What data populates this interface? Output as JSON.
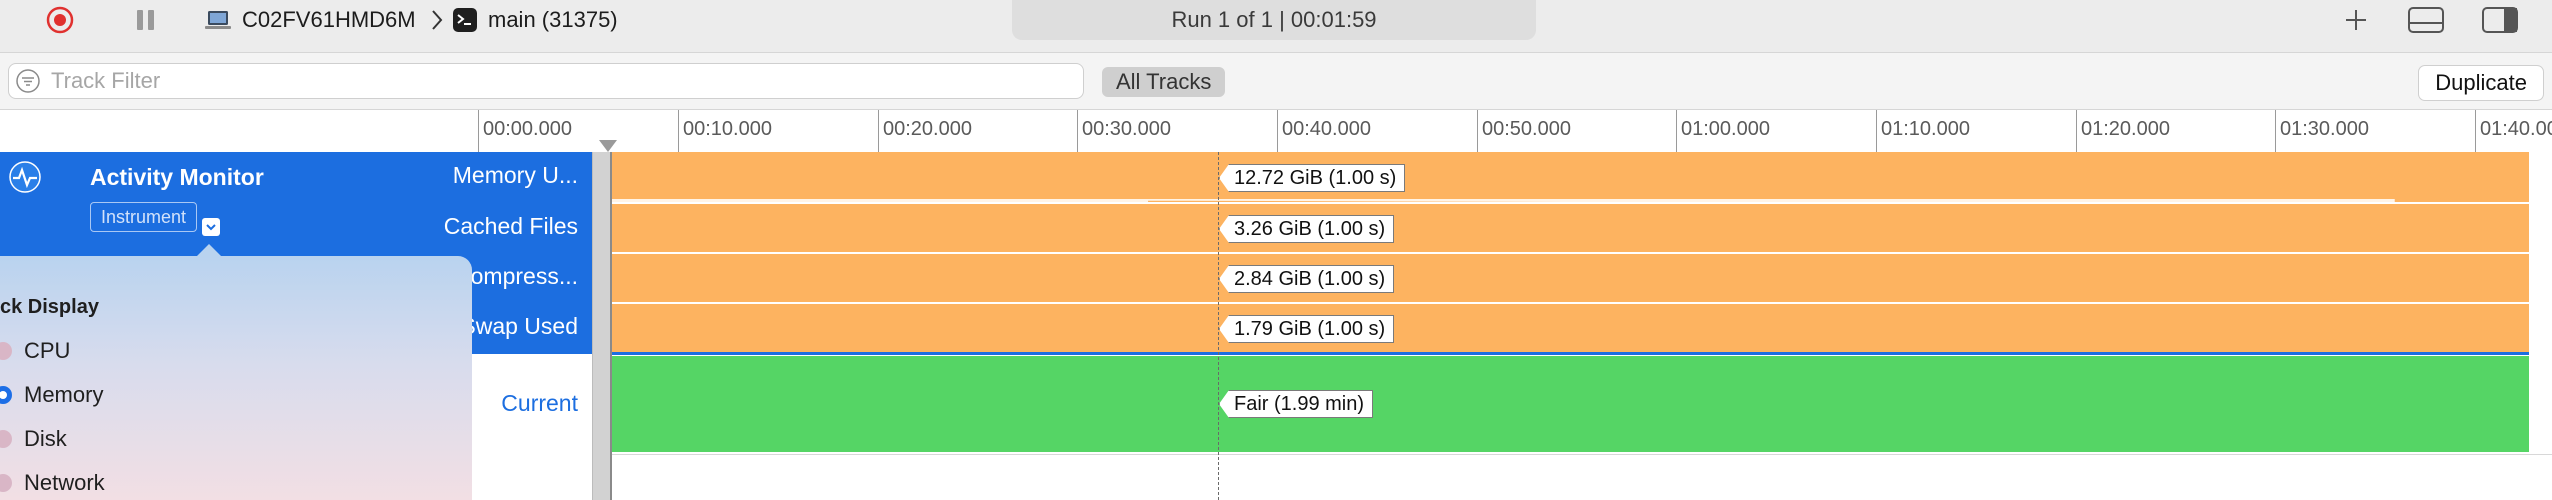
{
  "toolbar": {
    "device_name": "C02FV61HMD6M",
    "target_name": "main (31375)",
    "run_status": "Run 1 of 1  |  00:01:59"
  },
  "filter": {
    "placeholder": "Track Filter",
    "all_tracks_label": "All Tracks",
    "duplicate_label": "Duplicate"
  },
  "ruler": {
    "ticks": [
      "00:00.000",
      "00:10.000",
      "00:20.000",
      "00:30.000",
      "00:40.000",
      "00:50.000",
      "01:00.000",
      "01:10.000",
      "01:20.000",
      "01:30.000",
      "01:40.000"
    ]
  },
  "instrument": {
    "name": "Activity Monitor",
    "type_badge": "Instrument"
  },
  "tracks": [
    {
      "label": "Memory U...",
      "value": "12.72 GiB (1.00 s)",
      "color": "#fdb360"
    },
    {
      "label": "Cached Files",
      "value": "3.26 GiB (1.00 s)",
      "color": "#fdb360"
    },
    {
      "label": "Compress...",
      "value": "2.84 GiB (1.00 s)",
      "color": "#fdb360"
    },
    {
      "label": "Swap Used",
      "value": "1.79 GiB (1.00 s)",
      "color": "#fdb360"
    },
    {
      "label": "Current",
      "value": "Fair (1.99 min)",
      "color": "#55d565"
    }
  ],
  "track_display": {
    "title": "ck Display",
    "options": [
      {
        "label": "CPU",
        "selected": false
      },
      {
        "label": "Memory",
        "selected": true
      },
      {
        "label": "Disk",
        "selected": false
      },
      {
        "label": "Network",
        "selected": false
      }
    ]
  },
  "colors": {
    "accent": "#1c6ee0",
    "memory_fill": "#fdb360",
    "pressure_fill": "#55d565",
    "record": "#e0312f"
  }
}
